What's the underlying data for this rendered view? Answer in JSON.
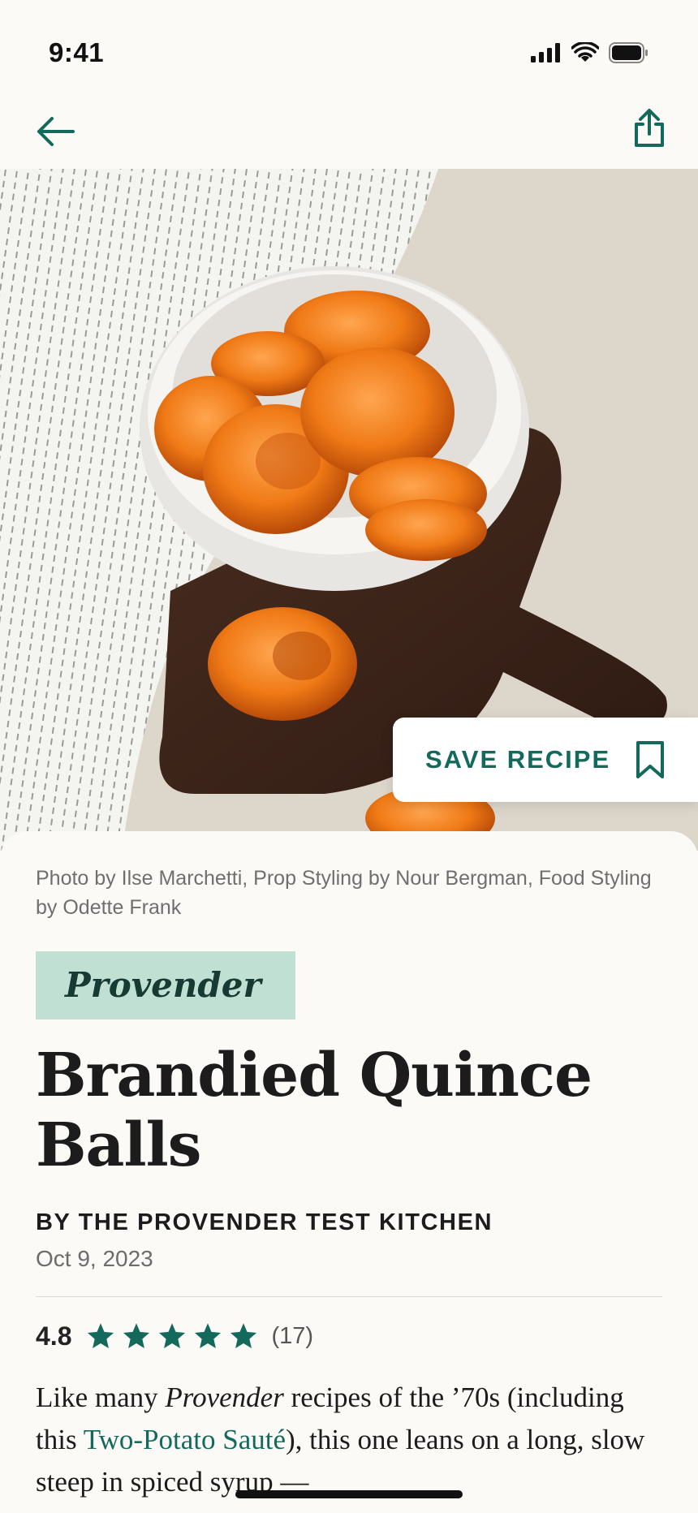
{
  "status_bar": {
    "time": "9:41"
  },
  "hero": {
    "save_button_label": "SAVE RECIPE"
  },
  "article": {
    "photo_credit": "Photo by Ilse Marchetti, Prop Styling by Nour Bergman, Food Styling by Odette Frank",
    "brand": "Provender",
    "title": "Brandied Quince Balls",
    "byline": "BY THE PROVENDER TEST KITCHEN",
    "date": "Oct 9, 2023",
    "rating": {
      "value": "4.8",
      "stars": 5,
      "count": "(17)"
    },
    "description": {
      "part1": "Like many ",
      "brand_italic": "Provender",
      "part2": " recipes of the ’70s (including this ",
      "link": "Two-Potato Sauté",
      "part3": "), this one leans on a long, slow steep in spiced syrup —"
    }
  },
  "colors": {
    "accent": "#136a5c",
    "badge_bg": "#bfe0d3",
    "background": "#fbfaf6"
  },
  "icons": {
    "back": "arrow-left-icon",
    "share": "share-icon",
    "save": "bookmark-icon",
    "star": "star-icon"
  }
}
